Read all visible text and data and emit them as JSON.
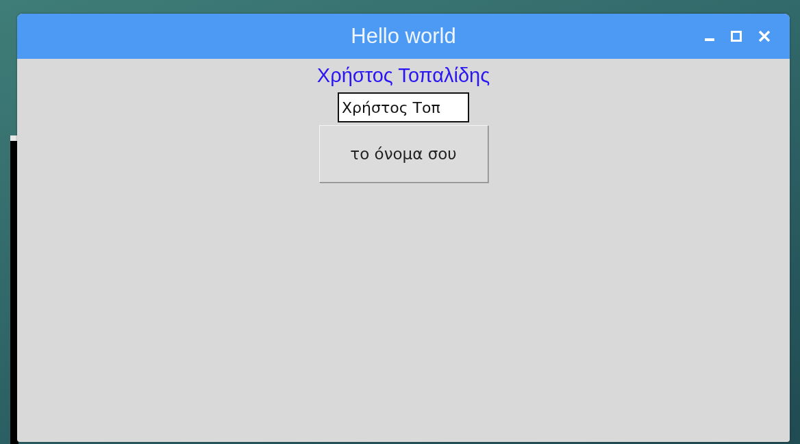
{
  "window": {
    "title": "Hello world"
  },
  "label": {
    "text": "Χρήστος Τοπαλίδης"
  },
  "entry": {
    "value": "Χρήστος Τοπ"
  },
  "button": {
    "label": "το όνομα σου"
  }
}
